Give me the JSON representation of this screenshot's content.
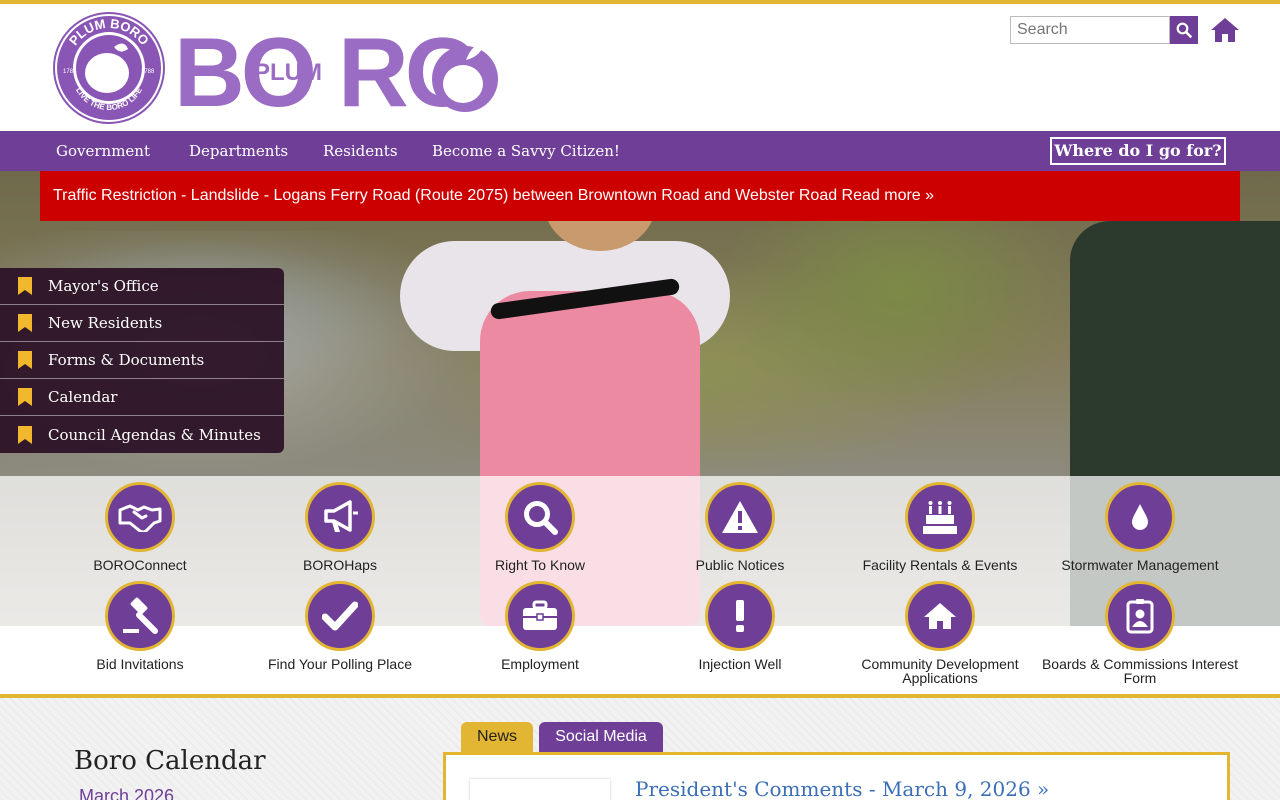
{
  "header": {
    "seal_top_text": "PLUM BORO",
    "seal_bottom_text": "LIVE THE BORO LIFE",
    "seal_year_left": "1788",
    "seal_year_right": "1788",
    "wordmark_small": "PLUM",
    "wordmark_big_left": "BO",
    "wordmark_big_right": "RO",
    "search_placeholder": "Search",
    "search_icon": "search-icon",
    "home_icon": "home-icon"
  },
  "nav": {
    "items": [
      {
        "label": "Government"
      },
      {
        "label": "Departments"
      },
      {
        "label": "Residents"
      },
      {
        "label": "Become a Savvy Citizen!"
      }
    ],
    "where_label": "Where do I go for?"
  },
  "alert": {
    "text": "Traffic Restriction - Landslide - Logans Ferry Road (Route 2075) between Browntown Road and Webster Road Read more »"
  },
  "side_menu": [
    {
      "label": "Mayor's Office"
    },
    {
      "label": "New Residents"
    },
    {
      "label": "Forms & Documents"
    },
    {
      "label": "Calendar"
    },
    {
      "label": "Council Agendas & Minutes"
    }
  ],
  "quick_links": [
    {
      "label": "BOROConnect",
      "icon": "handshake-icon"
    },
    {
      "label": "BOROHaps",
      "icon": "megaphone-icon"
    },
    {
      "label": "Right To Know",
      "icon": "search-icon"
    },
    {
      "label": "Public Notices",
      "icon": "warning-icon"
    },
    {
      "label": "Facility Rentals & Events",
      "icon": "cake-icon"
    },
    {
      "label": "Stormwater Management",
      "icon": "water-drop-icon"
    },
    {
      "label": "Bid Invitations",
      "icon": "gavel-icon"
    },
    {
      "label": "Find Your Polling Place",
      "icon": "checkmark-icon"
    },
    {
      "label": "Employment",
      "icon": "briefcase-icon"
    },
    {
      "label": "Injection Well",
      "icon": "exclamation-icon"
    },
    {
      "label": "Community Development Applications",
      "icon": "house-icon"
    },
    {
      "label": "Boards & Commissions Interest Form",
      "icon": "id-badge-icon"
    }
  ],
  "calendar": {
    "title": "Boro Calendar",
    "month": "March 2026"
  },
  "tabs": {
    "news": "News",
    "social": "Social Media"
  },
  "news": {
    "first_title": "President's Comments - March 9, 2026 »"
  },
  "colors": {
    "purple": "#6f3f98",
    "gold": "#e2b533",
    "alert_red": "#cd0000"
  }
}
